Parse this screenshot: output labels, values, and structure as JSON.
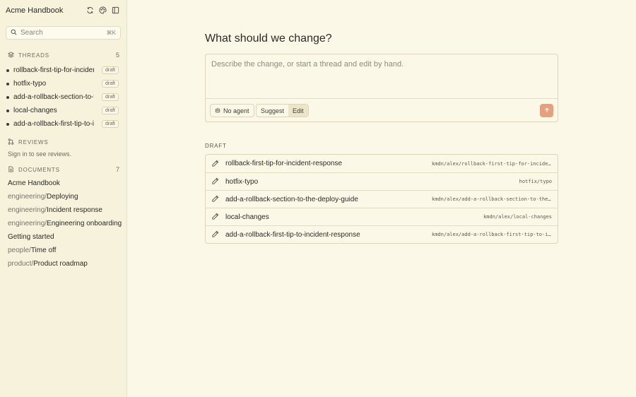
{
  "app": {
    "title": "Acme Handbook"
  },
  "search": {
    "placeholder": "Search",
    "shortcut": "⌘K"
  },
  "threads": {
    "label": "THREADS",
    "count": "5",
    "items": [
      {
        "label": "rollback-first-tip-for-incident-response",
        "badge": "draft"
      },
      {
        "label": "hotfix-typo",
        "badge": "draft"
      },
      {
        "label": "add-a-rollback-section-to-the-deploy-guide",
        "badge": "draft"
      },
      {
        "label": "local-changes",
        "badge": "draft"
      },
      {
        "label": "add-a-rollback-first-tip-to-incident-response",
        "badge": "draft"
      }
    ]
  },
  "reviews": {
    "label": "REVIEWS",
    "note": "Sign in to see reviews."
  },
  "documents": {
    "label": "DOCUMENTS",
    "count": "7",
    "items": [
      {
        "prefix": "",
        "name": "Acme Handbook"
      },
      {
        "prefix": "engineering/",
        "name": "Deploying"
      },
      {
        "prefix": "engineering/",
        "name": "Incident response"
      },
      {
        "prefix": "engineering/",
        "name": "Engineering onboarding"
      },
      {
        "prefix": "",
        "name": "Getting started"
      },
      {
        "prefix": "people/",
        "name": "Time off"
      },
      {
        "prefix": "product/",
        "name": "Product roadmap"
      }
    ]
  },
  "main": {
    "heading": "What should we change?",
    "composer": {
      "placeholder": "Describe the change, or start a thread and edit by hand.",
      "agent_label": "No agent",
      "modes": [
        "Suggest",
        "Edit"
      ],
      "active_mode": "Edit"
    },
    "drafts": {
      "label": "DRAFT",
      "rows": [
        {
          "name": "rollback-first-tip-for-incident-response",
          "branch": "kmdn/alex/rollback-first-tip-for-incident-response"
        },
        {
          "name": "hotfix-typo",
          "branch": "hotfix/typo"
        },
        {
          "name": "add-a-rollback-section-to-the-deploy-guide",
          "branch": "kmdn/alex/add-a-rollback-section-to-the-deploy-guide"
        },
        {
          "name": "local-changes",
          "branch": "kmdn/alex/local-changes"
        },
        {
          "name": "add-a-rollback-first-tip-to-incident-response",
          "branch": "kmdn/alex/add-a-rollback-first-tip-to-incident-response"
        }
      ]
    }
  },
  "colors": {
    "background": "#fcf8e7",
    "sidebar": "#f7f2dc",
    "accent": "#e6a07f"
  }
}
